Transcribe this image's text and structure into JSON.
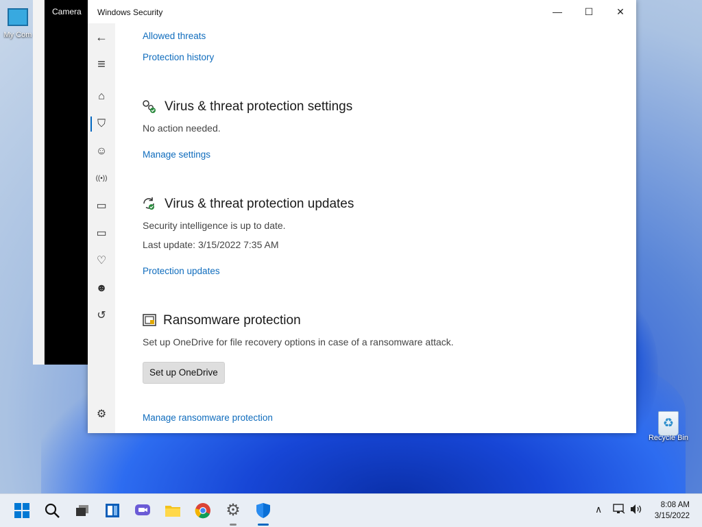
{
  "desktop": {
    "icons": [
      {
        "label": "My Com"
      },
      {
        "label": "Recycle Bin"
      }
    ]
  },
  "camera_window": {
    "title": "Camera"
  },
  "window": {
    "title": "Windows Security",
    "controls": {
      "minimize": "—",
      "maximize": "☐",
      "close": "✕"
    }
  },
  "nav": {
    "back": "←",
    "menu": "≡",
    "items": [
      {
        "name": "home",
        "glyph": "⌂"
      },
      {
        "name": "virus-protection",
        "glyph": "⛉"
      },
      {
        "name": "account",
        "glyph": "☺"
      },
      {
        "name": "firewall",
        "glyph": "((•))"
      },
      {
        "name": "app-browser",
        "glyph": "▭"
      },
      {
        "name": "device-security",
        "glyph": "▭"
      },
      {
        "name": "device-health",
        "glyph": "♡"
      },
      {
        "name": "family",
        "glyph": "☻"
      },
      {
        "name": "history",
        "glyph": "↺"
      }
    ],
    "settings": "⚙"
  },
  "content": {
    "top_links": {
      "allowed_threats": "Allowed threats",
      "protection_history": "Protection history"
    },
    "settings_section": {
      "title": "Virus & threat protection settings",
      "status": "No action needed.",
      "link": "Manage settings"
    },
    "updates_section": {
      "title": "Virus & threat protection updates",
      "status": "Security intelligence is up to date.",
      "last_update": "Last update: 3/15/2022 7:35 AM",
      "link": "Protection updates"
    },
    "ransomware_section": {
      "title": "Ransomware protection",
      "description": "Set up OneDrive for file recovery options in case of a ransomware attack.",
      "button": "Set up OneDrive",
      "link": "Manage ransomware protection"
    }
  },
  "taskbar": {
    "time": "8:08 AM",
    "date": "3/15/2022"
  },
  "colors": {
    "link": "#0f6cbd",
    "accent": "#0067c0"
  }
}
